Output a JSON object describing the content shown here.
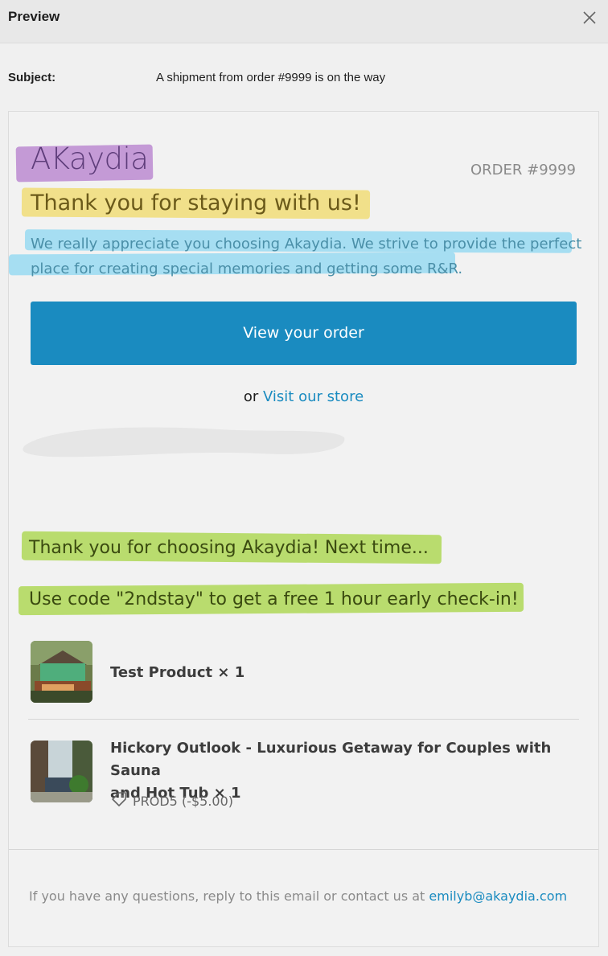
{
  "dialog": {
    "title": "Preview",
    "close_icon": "close-icon"
  },
  "subject": {
    "label": "Subject:",
    "value": "A shipment from order #9999 is on the way"
  },
  "email": {
    "brand": "AKaydia",
    "order_number": "ORDER #9999",
    "heading": "Thank you for staying with us!",
    "intro_line1": "We really appreciate you choosing Akaydia. We strive to provide the perfect",
    "intro_line2": "place for creating special memories and getting some R&R.",
    "cta_label": "View your order",
    "or_text": "or",
    "store_link": "Visit our store",
    "promo_line1": "Thank you for choosing Akaydia! Next time...",
    "promo_line2": "Use code \"2ndstay\" to get a free 1 hour early check-in!",
    "items": [
      {
        "name": "Test Product × 1"
      },
      {
        "name_line1": "Hickory Outlook - Luxurious Getaway for Couples with Sauna",
        "name_line2": "and Hot Tub × 1",
        "coupon": "PROD5 (-$5.00)",
        "coupon_icon": "tag-icon"
      }
    ],
    "footer_text": "If you have any questions, reply to this email or contact us at",
    "footer_email": "emilyb@akaydia.com"
  },
  "colors": {
    "accent": "#1a8bc0",
    "highlight_purple": "#c49ad6",
    "highlight_yellow": "#f1e08a",
    "highlight_blue": "#a6def2",
    "highlight_green": "#b9dc6e"
  }
}
